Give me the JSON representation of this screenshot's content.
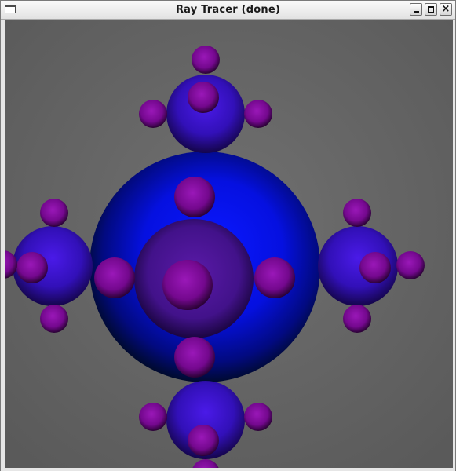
{
  "window": {
    "title": "Ray Tracer (done)",
    "icons": {
      "menu": "window-menu-icon",
      "minimize": "minimize-icon",
      "maximize": "maximize-icon",
      "close": "close-icon"
    },
    "close_glyph": "×"
  },
  "render": {
    "background_color": "#686868",
    "blue_sphere_color": "#0a0aff",
    "satellite_sphere_color": "#3a10b8",
    "small_sphere_color": "#8a0fa0"
  }
}
